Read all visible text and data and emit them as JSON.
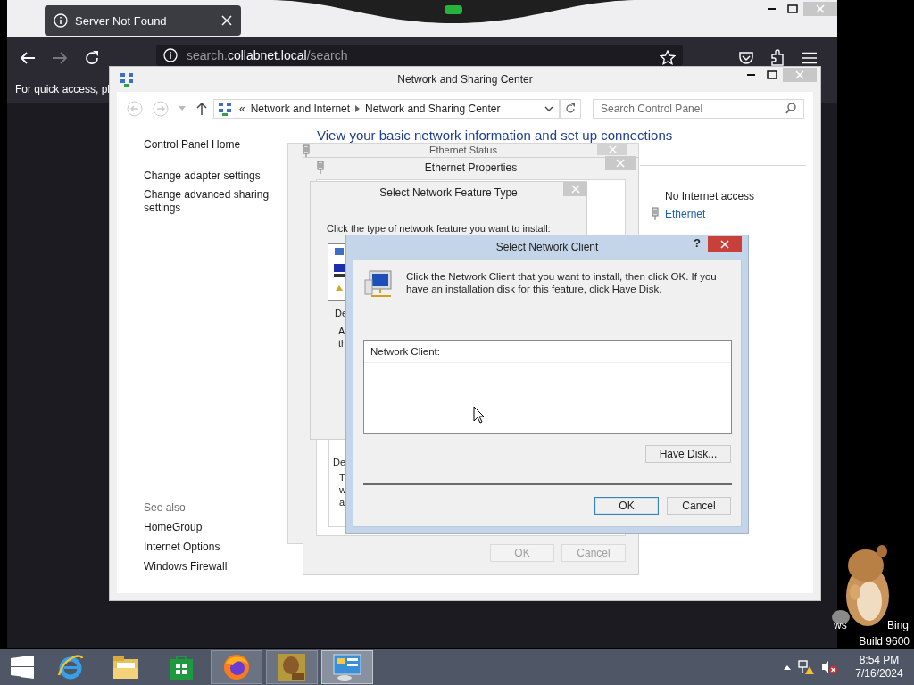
{
  "browser": {
    "notification": "Server Not Found",
    "url": {
      "prefix": "search.",
      "host": "collabnet.local",
      "path": "/search"
    },
    "page_text": "For quick access, pl"
  },
  "control_panel": {
    "title": "Network and Sharing Center",
    "breadcrumb_overflow": "«",
    "breadcrumb": [
      "Network and Internet",
      "Network and Sharing Center"
    ],
    "search": {
      "placeholder": "Search Control Panel"
    },
    "nav_links": [
      "Control Panel Home",
      "Change adapter settings",
      "Change advanced sharing settings"
    ],
    "see_also_label": "See also",
    "see_also_links": [
      "HomeGroup",
      "Internet Options",
      "Windows Firewall"
    ],
    "heading": "View your basic network information and set up connections",
    "access_type": "No Internet access",
    "connection_link": "Ethernet"
  },
  "ethernet_status": {
    "title": "Ethernet Status"
  },
  "ethernet_properties": {
    "title": "Ethernet Properties",
    "description_label": "De",
    "description_lines": [
      "T",
      "w",
      "a"
    ],
    "buttons": [
      {
        "label": "OK",
        "disabled": true
      },
      {
        "label": "Cancel",
        "disabled": true
      }
    ]
  },
  "feature_type_dialog": {
    "title": "Select Network Feature Type",
    "instruction": "Click the type of network feature you want to install:",
    "description_label": "De",
    "description_lines": [
      "A",
      "th"
    ]
  },
  "client_dialog": {
    "title": "Select Network Client",
    "help": "?",
    "message": "Click the Network Client that you want to install, then click OK. If you have an installation disk for this feature, click Have Disk.",
    "list_header": "Network Client:",
    "have_disk": "Have Disk...",
    "buttons": [
      {
        "label": "OK",
        "default": true
      },
      {
        "label": "Cancel",
        "default": false
      }
    ]
  },
  "desktop": {
    "watermark": [
      "ws",
      "Bing"
    ],
    "build": "Build 9600"
  },
  "taskbar": {
    "apps": [
      {
        "kind": "ie",
        "running": false,
        "selected": false
      },
      {
        "kind": "explorer",
        "running": false,
        "selected": false
      },
      {
        "kind": "store",
        "running": false,
        "selected": false
      },
      {
        "kind": "firefox",
        "running": true,
        "selected": false
      },
      {
        "kind": "pet",
        "running": true,
        "selected": false
      },
      {
        "kind": "control-panel",
        "running": true,
        "selected": true
      }
    ],
    "clock": {
      "time": "8:54 PM",
      "date": "7/16/2024"
    }
  }
}
